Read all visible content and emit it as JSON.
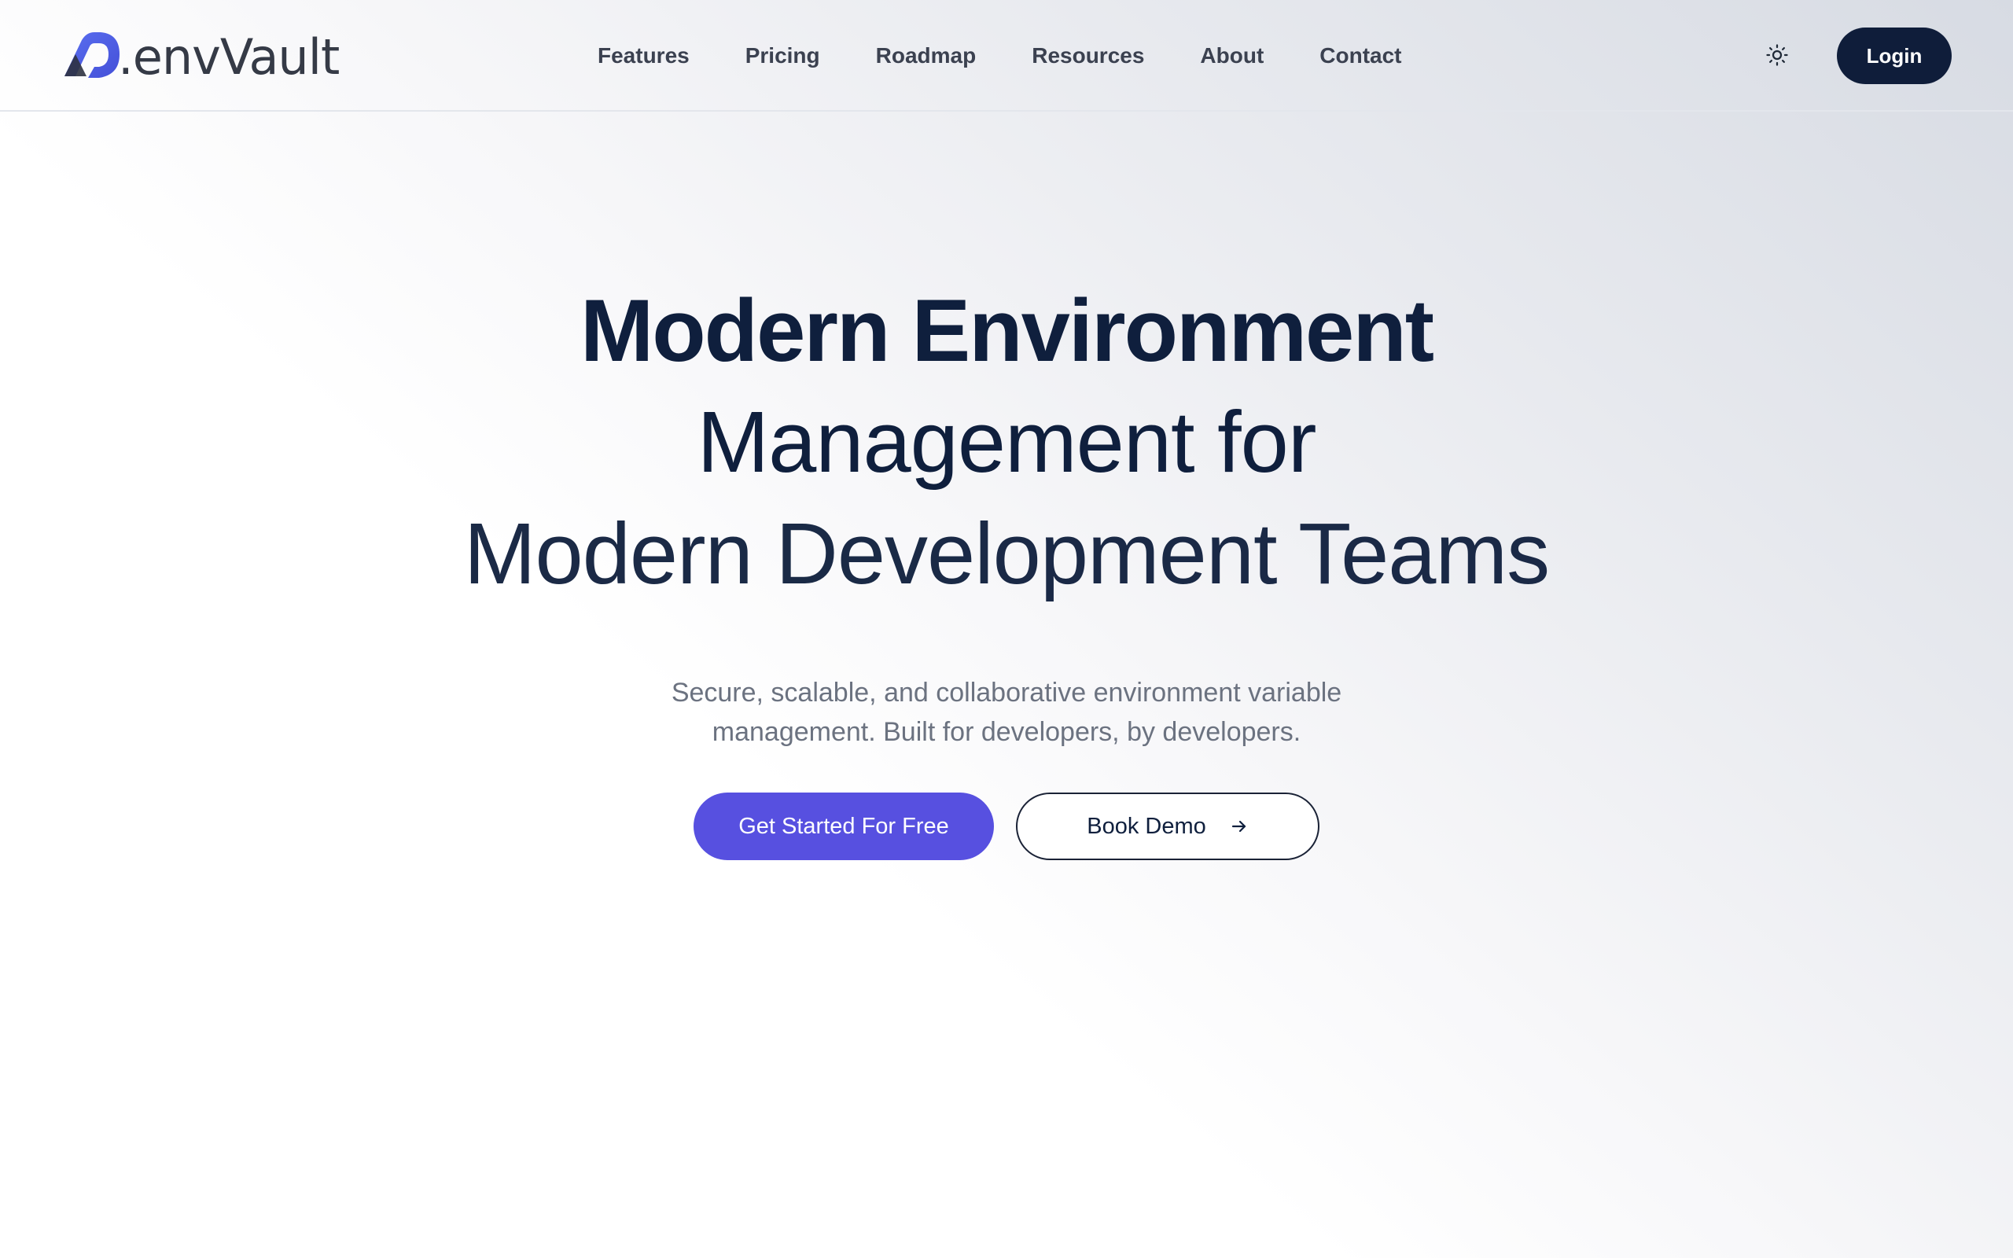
{
  "brand": {
    "name": ".envVault",
    "accent_color": "#5750e0",
    "dark_color": "#0f1d3a"
  },
  "nav": {
    "items": [
      {
        "label": "Features"
      },
      {
        "label": "Pricing"
      },
      {
        "label": "Roadmap"
      },
      {
        "label": "Resources"
      },
      {
        "label": "About"
      },
      {
        "label": "Contact"
      }
    ]
  },
  "header": {
    "theme_icon": "sun-icon",
    "login_label": "Login"
  },
  "hero": {
    "line1": "Modern Environment",
    "line2": "Management for",
    "line3": "Modern Development Teams",
    "subtitle": "Secure, scalable, and collaborative environment variable management. Built for developers, by developers.",
    "primary_cta": "Get Started For Free",
    "secondary_cta": "Book Demo",
    "secondary_cta_icon": "arrow-right-icon"
  }
}
